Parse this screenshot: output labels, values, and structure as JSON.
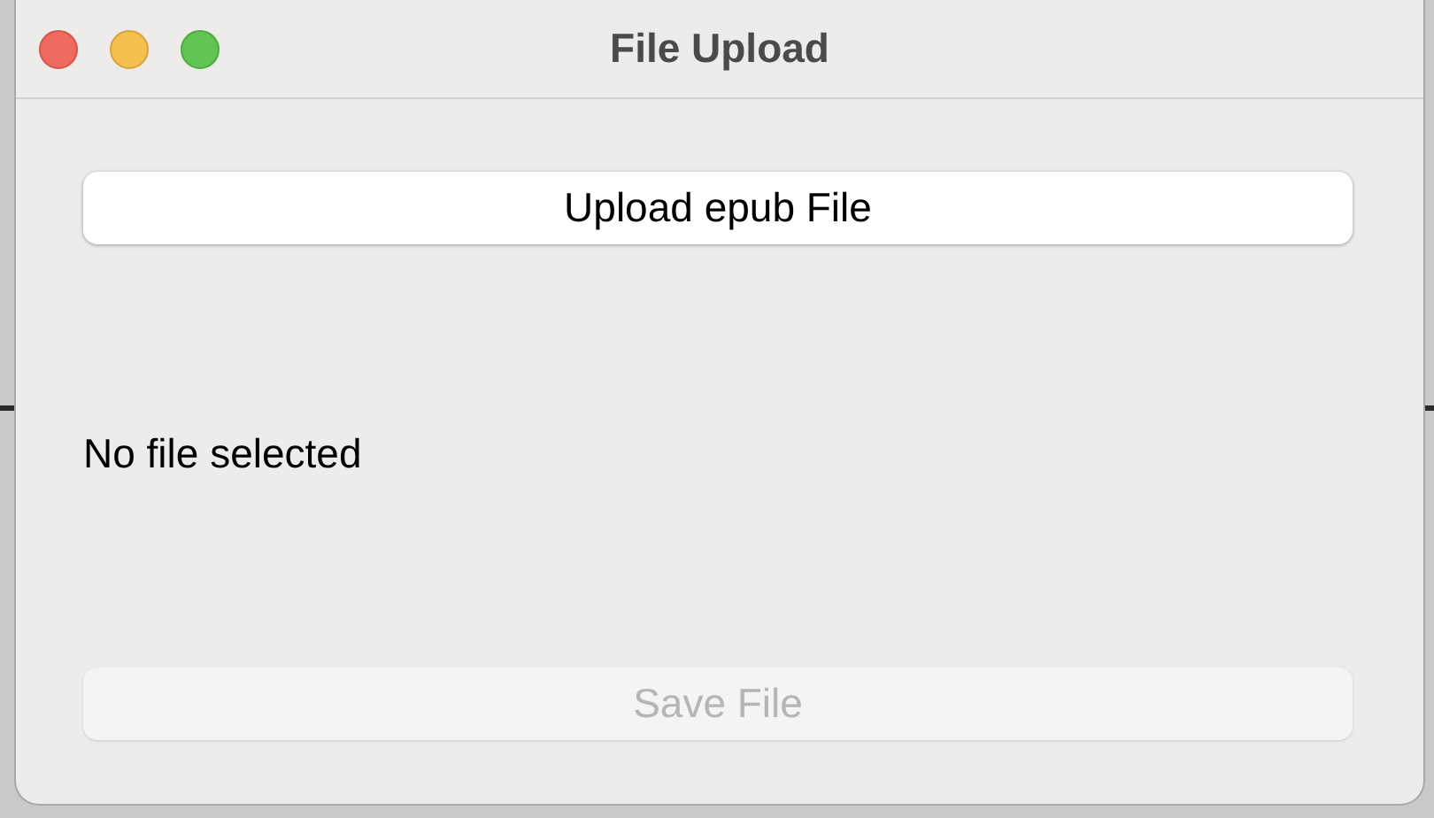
{
  "window": {
    "title": "File Upload"
  },
  "upload_button": {
    "label": "Upload epub File",
    "disabled": false
  },
  "status_text": "No file selected",
  "save_button": {
    "label": "Save File",
    "disabled": true
  }
}
